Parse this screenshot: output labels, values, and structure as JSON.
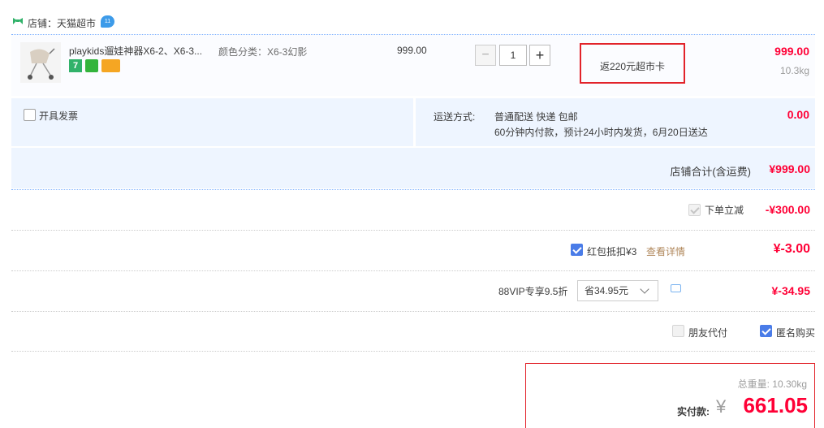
{
  "shop": {
    "label": "店铺：天猫超市",
    "badge": "11"
  },
  "item": {
    "title": "playkids遛娃神器X6-2、X6-3...",
    "sku": "颜色分类：X6-3幻影",
    "service_badge_1": "7",
    "unit_price": "999.00",
    "quantity": "1",
    "minus_label": "−",
    "plus_label": "+",
    "promo": "返220元超市卡",
    "line_total": "999.00",
    "weight": "10.3kg"
  },
  "invoice": {
    "label": "开具发票"
  },
  "shipping": {
    "label": "运送方式:",
    "method": "普通配送 快递 包邮",
    "note": "60分钟内付款，预计24小时内发货，6月20日送达",
    "fee": "0.00"
  },
  "shop_total": {
    "label": "店铺合计(含运费)",
    "value": "¥999.00"
  },
  "discounts": {
    "order_discount_label": "下单立减",
    "order_discount_value": "-¥300.00",
    "red_packet_label": "红包抵扣¥3",
    "red_packet_link": "查看详情",
    "red_packet_value": "¥-3.00",
    "vip_label": "88VIP专享9.5折",
    "vip_select_value": "省34.95元",
    "vip_value": "¥-34.95"
  },
  "options": {
    "friend_pay_label": "朋友代付",
    "anonymous_label": "匿名购买"
  },
  "payment": {
    "total_weight": "总重量: 10.30kg",
    "label": "实付款:",
    "currency": "¥",
    "amount": "661.05"
  },
  "colors": {
    "price_red": "#ff0036",
    "accent_blue": "#4a7ce8",
    "highlight_border": "#e2232a"
  }
}
